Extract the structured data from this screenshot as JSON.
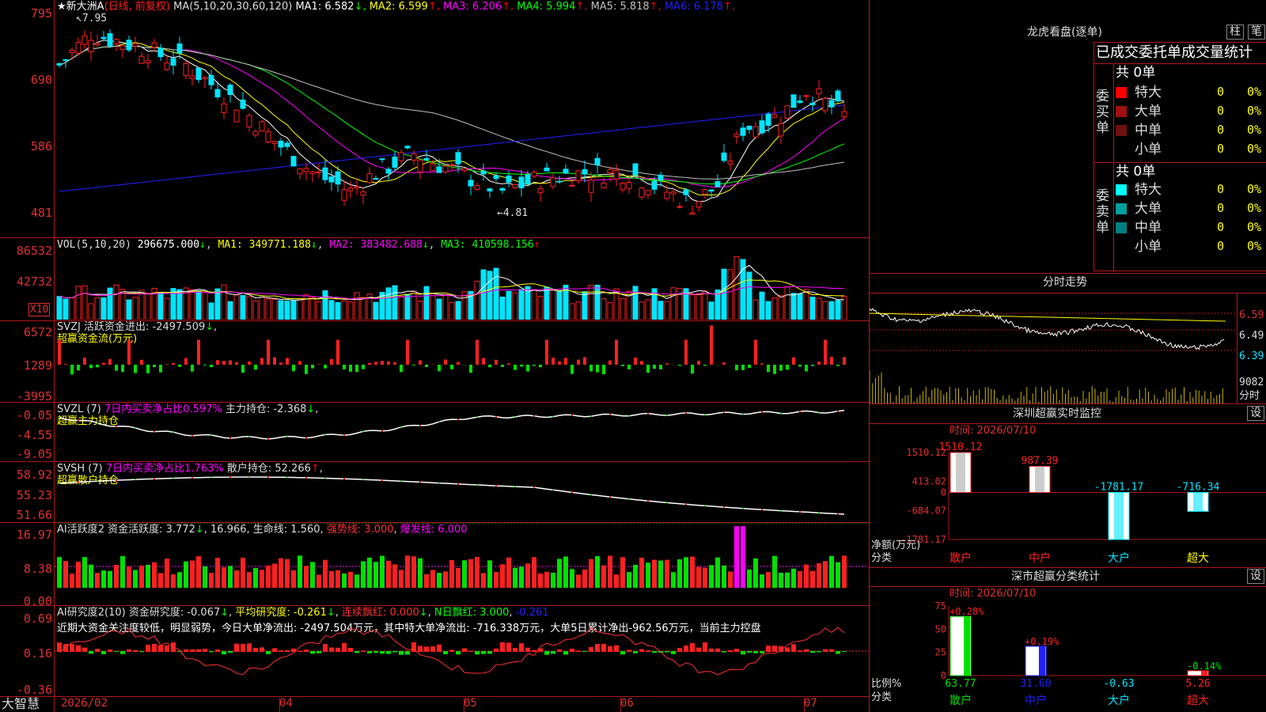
{
  "colors": {
    "up": "#ff2020",
    "down": "#00e5ff",
    "frame": "#b01818",
    "axis": "#e03030"
  },
  "main": {
    "star": "★",
    "name": "新大洲A",
    "period": "(日线, 前复权)",
    "ma_label": "MA(5,10,20,30,60,120)",
    "ma": [
      {
        "t": "MA1: 6.582",
        "a": "↓",
        "c": "#ffffff"
      },
      {
        "t": "MA2: 6.599",
        "a": "↑",
        "c": "#ffff00"
      },
      {
        "t": "MA3: 6.206",
        "a": "↑",
        "c": "#ff00ff"
      },
      {
        "t": "MA4: 5.994",
        "a": "↑",
        "c": "#00ff00"
      },
      {
        "t": "MA5: 5.818",
        "a": "↑",
        "c": "#c0c0c0"
      },
      {
        "t": "MA6: 6.178",
        "a": "↑",
        "c": "#2020ff"
      }
    ],
    "yticks": [
      "795",
      "690",
      "586",
      "481"
    ],
    "hi_label": "7.95",
    "lo_label": "4.81"
  },
  "vol": {
    "title": "VOL(5,10,20)",
    "value": "296675.000",
    "ma1": "MA1: 349771.188",
    "ma2": "MA2: 383482.688",
    "ma3": "MA3: 410598.156",
    "yticks": [
      "86532",
      "42732"
    ],
    "unit": "X10"
  },
  "svzj": {
    "title": "SVZJ  活跃资金进出: -2497.509",
    "sub": "超赢资金流(万元)",
    "yticks": [
      "6572",
      "1289",
      "-3995"
    ]
  },
  "svzl": {
    "title": "SVZL (7)",
    "pct": "7日内买卖净占比0.597%",
    "main": "主力持仓: -2.368",
    "sub": "超赢主力持仓",
    "yticks": [
      "-0.05",
      "-4.55",
      "-9.05"
    ]
  },
  "svsh": {
    "title": "SVSH (7)",
    "pct": "7日内买卖净占比1.763%",
    "main": "散户持仓: 52.266",
    "sub": "超赢散户持仓",
    "yticks": [
      "58.92",
      "55.23",
      "51.66"
    ]
  },
  "ai1": {
    "title": "AI活跃度2 资金活跃度: 3.772",
    "v2": "16.966",
    "life": "生命线: 1.560",
    "strong": "强势线: 3.000",
    "burst": "爆发线: 6.000",
    "yticks": [
      "16.97",
      "8.38",
      "0.00"
    ]
  },
  "ai2": {
    "title": "AI研究度2(10) 资金研究度: -0.067",
    "avg": "平均研究度: -0.261",
    "red": "连续飘红: 0.000",
    "nred": "N日飘红: 3.000",
    "last": "-0.261",
    "comment": "近期大资金关注度较低，明显弱势，今日大单净流出: -2497.504万元，其中特大单净流出: -716.338万元，大单5日累计净出-962.56万元，当前主力控盘",
    "yticks": [
      "0.69",
      "0.16",
      "-0.36"
    ]
  },
  "xaxis": {
    "brand": "大智慧",
    "labels": [
      "2026/02",
      "04",
      "05",
      "06",
      "07"
    ]
  },
  "right": {
    "lhb_title": "龙虎看盘(逐单)",
    "btn_bar": "柱",
    "btn_pen": "笔",
    "stats_title": "已成交委托单成交量统计",
    "buy": {
      "side": "委买单",
      "total": "共 0单",
      "rows": [
        {
          "label": "特大",
          "v": "0",
          "p": "0%",
          "c": "#ff0000"
        },
        {
          "label": "大单",
          "v": "0",
          "p": "0%",
          "c": "#a01010"
        },
        {
          "label": "中单",
          "v": "0",
          "p": "0%",
          "c": "#701010"
        },
        {
          "label": "小单",
          "v": "0",
          "p": "0%",
          "c": ""
        }
      ]
    },
    "sell": {
      "side": "委卖单",
      "total": "共 0单",
      "rows": [
        {
          "label": "特大",
          "v": "0",
          "p": "0%",
          "c": "#00ffff"
        },
        {
          "label": "大单",
          "v": "0",
          "p": "0%",
          "c": "#00a0a0"
        },
        {
          "label": "中单",
          "v": "0",
          "p": "0%",
          "c": "#008080"
        },
        {
          "label": "小单",
          "v": "0",
          "p": "0%",
          "c": ""
        }
      ]
    },
    "intraday": {
      "title": "分时走势",
      "prices": [
        "6.59",
        "6.49",
        "6.39"
      ],
      "vol": "9082",
      "vol_unit": "分时"
    },
    "monitor": {
      "title": "深圳超赢实时监控",
      "btn": "设",
      "date": "时间: 2026/07/10",
      "yticks": [
        "1510.12",
        "413.02",
        "0",
        "-684.07",
        "-1781.17"
      ],
      "ylabel": "净额(万元)",
      "xlabel": "分类",
      "cats": [
        "散户",
        "中户",
        "大户",
        "超大"
      ],
      "vals": [
        "1510.12",
        "987.39",
        "-1781.17",
        "-716.34"
      ]
    },
    "classify": {
      "title": "深市超赢分类统计",
      "btn": "设",
      "date": "时间: 2026/07/10",
      "yticks": [
        "75",
        "50",
        "25",
        "0"
      ],
      "ylabel": "比例%",
      "xlabel": "分类",
      "cats": [
        "散户",
        "中户",
        "大户",
        "超大"
      ],
      "vals": [
        "63.77",
        "31.60",
        "-0.63",
        "5.26"
      ],
      "pcts": [
        "+0.28%",
        "+0.19%",
        "",
        "-0.14%"
      ]
    }
  },
  "chart_data": [
    {
      "type": "bar",
      "title": "深圳超赢实时监控",
      "ylabel": "净额(万元)",
      "categories": [
        "散户",
        "中户",
        "大户",
        "超大"
      ],
      "values": [
        1510.12,
        987.39,
        -1781.17,
        -716.34
      ],
      "ylim": [
        -1781.17,
        1510.12
      ]
    },
    {
      "type": "bar",
      "title": "深市超赢分类统计",
      "ylabel": "比例%",
      "categories": [
        "散户",
        "中户",
        "大户",
        "超大"
      ],
      "values": [
        63.77,
        31.6,
        -0.63,
        5.26
      ],
      "ylim": [
        0,
        75
      ]
    }
  ]
}
